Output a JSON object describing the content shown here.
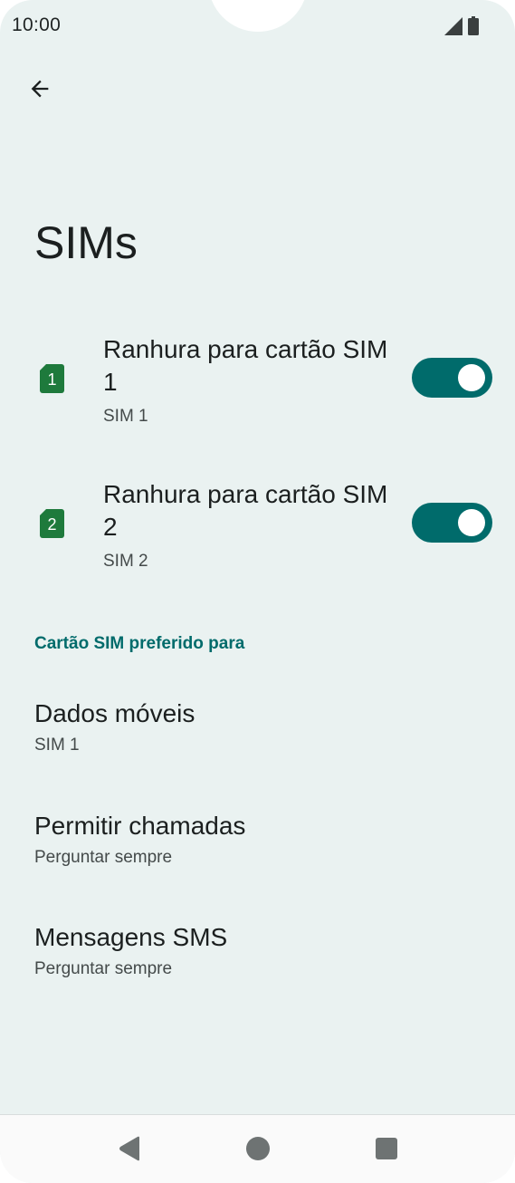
{
  "status_bar": {
    "time": "10:00",
    "icons": [
      "signal-icon",
      "battery-icon"
    ]
  },
  "toolbar": {
    "back_icon": "arrow-left-icon"
  },
  "page": {
    "title": "SIMs"
  },
  "sims": [
    {
      "badge": "1",
      "title": "Ranhura para cartão SIM 1",
      "subtitle": "SIM 1",
      "enabled": true
    },
    {
      "badge": "2",
      "title": "Ranhura para cartão SIM 2",
      "subtitle": "SIM 2",
      "enabled": true
    }
  ],
  "preferred": {
    "header": "Cartão SIM preferido para",
    "items": [
      {
        "title": "Dados móveis",
        "value": "SIM 1"
      },
      {
        "title": "Permitir chamadas",
        "value": "Perguntar sempre"
      },
      {
        "title": "Mensagens SMS",
        "value": "Perguntar sempre"
      }
    ]
  },
  "colors": {
    "background": "#eaf2f1",
    "accent": "#006b6b",
    "sim_badge": "#1e7a3c"
  },
  "nav_bar": {
    "icons": [
      "nav-back-icon",
      "nav-home-icon",
      "nav-recents-icon"
    ]
  }
}
